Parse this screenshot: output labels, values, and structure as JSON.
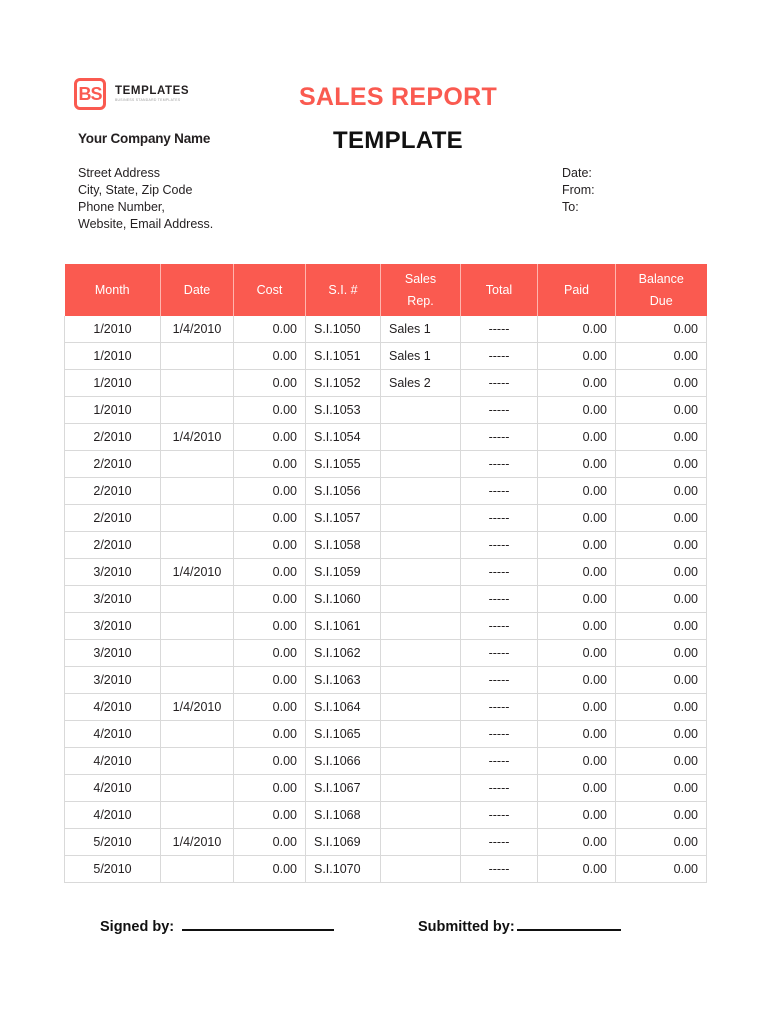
{
  "brand": {
    "logo_mark": "BS",
    "logo_title": "TEMPLATES",
    "logo_subtitle": "BUSINESS STANDARD TEMPLATES",
    "accent_color": "#FA5A50",
    "text_color": "#231F20"
  },
  "header": {
    "company_name": "Your Company Name",
    "address_lines": [
      "Street Address",
      "City, State, Zip Code",
      "Phone Number,",
      "Website, Email Address."
    ],
    "title": "SALES REPORT",
    "subtitle": "TEMPLATE",
    "meta_fields": [
      "Date:",
      "From:",
      "To:"
    ]
  },
  "table": {
    "columns": [
      "Month",
      "Date",
      "Cost",
      "S.I. #",
      "Sales Rep.",
      "Total",
      "Paid",
      "Balance Due"
    ],
    "column_lines": [
      [
        "Month"
      ],
      [
        "Date"
      ],
      [
        "Cost"
      ],
      [
        "S.I. #"
      ],
      [
        "Sales",
        "Rep."
      ],
      [
        "Total"
      ],
      [
        "Paid"
      ],
      [
        "Balance",
        "Due"
      ]
    ],
    "rows": [
      {
        "month": "1/2010",
        "date": "1/4/2010",
        "cost": "0.00",
        "si": "S.I.1050",
        "rep": "Sales 1",
        "total": "-----",
        "paid": "0.00",
        "balance": "0.00"
      },
      {
        "month": "1/2010",
        "date": "",
        "cost": "0.00",
        "si": "S.I.1051",
        "rep": "Sales 1",
        "total": "-----",
        "paid": "0.00",
        "balance": "0.00"
      },
      {
        "month": "1/2010",
        "date": "",
        "cost": "0.00",
        "si": "S.I.1052",
        "rep": "Sales 2",
        "total": "-----",
        "paid": "0.00",
        "balance": "0.00"
      },
      {
        "month": "1/2010",
        "date": "",
        "cost": "0.00",
        "si": "S.I.1053",
        "rep": "",
        "total": "-----",
        "paid": "0.00",
        "balance": "0.00"
      },
      {
        "month": "2/2010",
        "date": "1/4/2010",
        "cost": "0.00",
        "si": "S.I.1054",
        "rep": "",
        "total": "-----",
        "paid": "0.00",
        "balance": "0.00"
      },
      {
        "month": "2/2010",
        "date": "",
        "cost": "0.00",
        "si": "S.I.1055",
        "rep": "",
        "total": "-----",
        "paid": "0.00",
        "balance": "0.00"
      },
      {
        "month": "2/2010",
        "date": "",
        "cost": "0.00",
        "si": "S.I.1056",
        "rep": "",
        "total": "-----",
        "paid": "0.00",
        "balance": "0.00"
      },
      {
        "month": "2/2010",
        "date": "",
        "cost": "0.00",
        "si": "S.I.1057",
        "rep": "",
        "total": "-----",
        "paid": "0.00",
        "balance": "0.00"
      },
      {
        "month": "2/2010",
        "date": "",
        "cost": "0.00",
        "si": "S.I.1058",
        "rep": "",
        "total": "-----",
        "paid": "0.00",
        "balance": "0.00"
      },
      {
        "month": "3/2010",
        "date": "1/4/2010",
        "cost": "0.00",
        "si": "S.I.1059",
        "rep": "",
        "total": "-----",
        "paid": "0.00",
        "balance": "0.00"
      },
      {
        "month": "3/2010",
        "date": "",
        "cost": "0.00",
        "si": "S.I.1060",
        "rep": "",
        "total": "-----",
        "paid": "0.00",
        "balance": "0.00"
      },
      {
        "month": "3/2010",
        "date": "",
        "cost": "0.00",
        "si": "S.I.1061",
        "rep": "",
        "total": "-----",
        "paid": "0.00",
        "balance": "0.00"
      },
      {
        "month": "3/2010",
        "date": "",
        "cost": "0.00",
        "si": "S.I.1062",
        "rep": "",
        "total": "-----",
        "paid": "0.00",
        "balance": "0.00"
      },
      {
        "month": "3/2010",
        "date": "",
        "cost": "0.00",
        "si": "S.I.1063",
        "rep": "",
        "total": "-----",
        "paid": "0.00",
        "balance": "0.00"
      },
      {
        "month": "4/2010",
        "date": "1/4/2010",
        "cost": "0.00",
        "si": "S.I.1064",
        "rep": "",
        "total": "-----",
        "paid": "0.00",
        "balance": "0.00"
      },
      {
        "month": "4/2010",
        "date": "",
        "cost": "0.00",
        "si": "S.I.1065",
        "rep": "",
        "total": "-----",
        "paid": "0.00",
        "balance": "0.00"
      },
      {
        "month": "4/2010",
        "date": "",
        "cost": "0.00",
        "si": "S.I.1066",
        "rep": "",
        "total": "-----",
        "paid": "0.00",
        "balance": "0.00"
      },
      {
        "month": "4/2010",
        "date": "",
        "cost": "0.00",
        "si": "S.I.1067",
        "rep": "",
        "total": "-----",
        "paid": "0.00",
        "balance": "0.00"
      },
      {
        "month": "4/2010",
        "date": "",
        "cost": "0.00",
        "si": "S.I.1068",
        "rep": "",
        "total": "-----",
        "paid": "0.00",
        "balance": "0.00"
      },
      {
        "month": "5/2010",
        "date": "1/4/2010",
        "cost": "0.00",
        "si": "S.I.1069",
        "rep": "",
        "total": "-----",
        "paid": "0.00",
        "balance": "0.00"
      },
      {
        "month": "5/2010",
        "date": "",
        "cost": "0.00",
        "si": "S.I.1070",
        "rep": "",
        "total": "-----",
        "paid": "0.00",
        "balance": "0.00"
      }
    ]
  },
  "footer": {
    "signed_by_label": "Signed by:",
    "submitted_by_label": "Submitted by:"
  }
}
